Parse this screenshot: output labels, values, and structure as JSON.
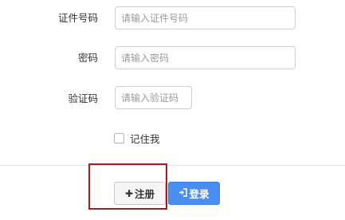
{
  "form": {
    "id_number": {
      "label": "证件号码",
      "placeholder": "请输入证件号码",
      "value": ""
    },
    "password": {
      "label": "密码",
      "placeholder": "请输入密码",
      "value": ""
    },
    "captcha": {
      "label": "验证码",
      "placeholder": "请输入验证码",
      "value": ""
    },
    "remember": {
      "label": "记住我",
      "checked": false
    }
  },
  "actions": {
    "register_label": "注册",
    "register_icon": "plus-icon",
    "login_label": "登录",
    "login_icon": "sign-in-icon"
  },
  "colors": {
    "login_button": "#4a8ff0",
    "highlight_box": "#a31f1f",
    "register_button": "#f5f5f5"
  }
}
